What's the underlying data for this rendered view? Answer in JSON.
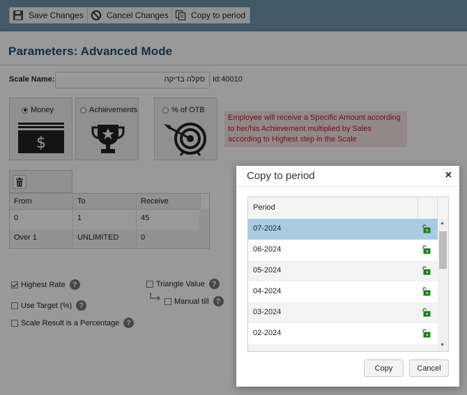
{
  "toolbar": {
    "save_label": "Save Changes",
    "cancel_label": "Cancel Changes",
    "copy_label": "Copy to period",
    "bg_color": "#6d95b0"
  },
  "page": {
    "title": "Parameters: Advanced Mode"
  },
  "scale": {
    "name_label": "Scale Name:",
    "name_value": "סקלה בדיקה",
    "id_text": "Id:40010"
  },
  "types": [
    {
      "label": "Money",
      "selected": true,
      "icon": "money-stack-icon"
    },
    {
      "label": "Achievements",
      "selected": false,
      "icon": "trophy-icon"
    },
    {
      "label": "% of OTB",
      "selected": false,
      "icon": "target-icon"
    }
  ],
  "type_description": "Employee will receive a Specific Amount according to her/his Achievement multiplied by Sales according to Highest step in the Scale",
  "steps": {
    "columns": [
      "From",
      "To",
      "Receive"
    ],
    "rows": [
      [
        "0",
        "1",
        "45"
      ],
      [
        "Over 1",
        "UNLIMITED",
        "0"
      ]
    ]
  },
  "options": {
    "highest_rate": {
      "label": "Highest Rate",
      "checked": true
    },
    "use_target": {
      "label": "Use Target (%)",
      "checked": false
    },
    "scale_result_pct": {
      "label": "Scale Result is a Percentage",
      "checked": false
    },
    "triangle_value": {
      "label": "Triangle Value",
      "checked": false
    },
    "manual_till": {
      "label": "Manual till",
      "checked": false
    }
  },
  "dialog": {
    "title": "Copy to period",
    "close_glyph": "×",
    "column_header": "Period",
    "periods": [
      "07-2024",
      "06-2024",
      "05-2024",
      "04-2024",
      "03-2024",
      "02-2024"
    ],
    "selected_period": "07-2024",
    "copy_label": "Copy",
    "cancel_label": "Cancel"
  },
  "colors": {
    "title": "#1f4e79",
    "description_text": "#b4232a",
    "selected_row": "#a9cbe0",
    "lock_green": "#1e8a1e"
  }
}
